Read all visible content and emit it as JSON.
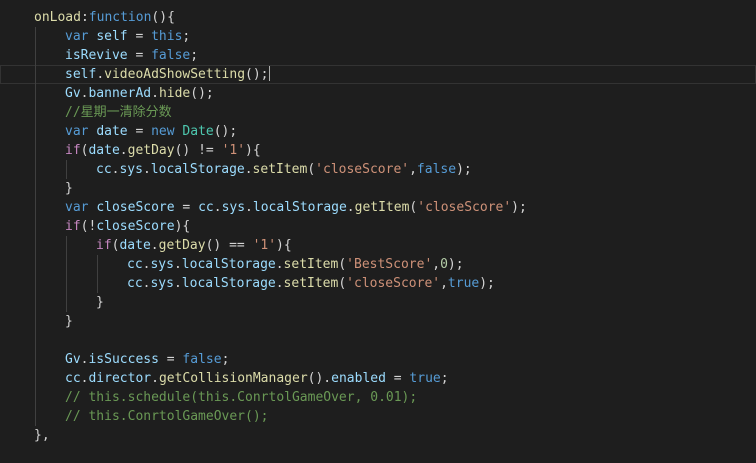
{
  "colors": {
    "background": "#1e1e1e",
    "default": "#d4d4d4",
    "keyword": "#569cd6",
    "identifier": "#9cdcfe",
    "function": "#dcdcaa",
    "string": "#ce9178",
    "comment": "#6a9955",
    "number": "#b5cea8",
    "control": "#c586c0",
    "class": "#4ec9b0",
    "indent_guide": "#404040"
  },
  "editor": {
    "lines": [
      {
        "indent": 0,
        "tokens": [
          {
            "t": "onLoad",
            "k": "function"
          },
          {
            "t": ":",
            "k": "default"
          },
          {
            "t": "function",
            "k": "keyword"
          },
          {
            "t": "(){",
            "k": "default"
          }
        ]
      },
      {
        "indent": 1,
        "tokens": [
          {
            "t": "var ",
            "k": "keyword"
          },
          {
            "t": "self",
            "k": "identifier"
          },
          {
            "t": " = ",
            "k": "default"
          },
          {
            "t": "this",
            "k": "keyword"
          },
          {
            "t": ";",
            "k": "default"
          }
        ]
      },
      {
        "indent": 1,
        "tokens": [
          {
            "t": "isRevive",
            "k": "identifier"
          },
          {
            "t": " = ",
            "k": "default"
          },
          {
            "t": "false",
            "k": "keyword"
          },
          {
            "t": ";",
            "k": "default"
          }
        ]
      },
      {
        "indent": 1,
        "current": true,
        "tokens": [
          {
            "t": "self",
            "k": "identifier"
          },
          {
            "t": ".",
            "k": "default"
          },
          {
            "t": "videoAdShowSetting",
            "k": "function"
          },
          {
            "t": "();",
            "k": "default"
          }
        ]
      },
      {
        "indent": 1,
        "tokens": [
          {
            "t": "Gv",
            "k": "identifier"
          },
          {
            "t": ".",
            "k": "default"
          },
          {
            "t": "bannerAd",
            "k": "identifier"
          },
          {
            "t": ".",
            "k": "default"
          },
          {
            "t": "hide",
            "k": "function"
          },
          {
            "t": "();",
            "k": "default"
          }
        ]
      },
      {
        "indent": 1,
        "tokens": [
          {
            "t": "//星期一清除分数",
            "k": "comment"
          }
        ]
      },
      {
        "indent": 1,
        "tokens": [
          {
            "t": "var ",
            "k": "keyword"
          },
          {
            "t": "date",
            "k": "identifier"
          },
          {
            "t": " = ",
            "k": "default"
          },
          {
            "t": "new ",
            "k": "keyword"
          },
          {
            "t": "Date",
            "k": "class"
          },
          {
            "t": "();",
            "k": "default"
          }
        ]
      },
      {
        "indent": 1,
        "tokens": [
          {
            "t": "if",
            "k": "control"
          },
          {
            "t": "(",
            "k": "default"
          },
          {
            "t": "date",
            "k": "identifier"
          },
          {
            "t": ".",
            "k": "default"
          },
          {
            "t": "getDay",
            "k": "function"
          },
          {
            "t": "() != ",
            "k": "default"
          },
          {
            "t": "'1'",
            "k": "string"
          },
          {
            "t": "){",
            "k": "default"
          }
        ]
      },
      {
        "indent": 2,
        "tokens": [
          {
            "t": "cc",
            "k": "identifier"
          },
          {
            "t": ".",
            "k": "default"
          },
          {
            "t": "sys",
            "k": "identifier"
          },
          {
            "t": ".",
            "k": "default"
          },
          {
            "t": "localStorage",
            "k": "identifier"
          },
          {
            "t": ".",
            "k": "default"
          },
          {
            "t": "setItem",
            "k": "function"
          },
          {
            "t": "(",
            "k": "default"
          },
          {
            "t": "'closeScore'",
            "k": "string"
          },
          {
            "t": ",",
            "k": "default"
          },
          {
            "t": "false",
            "k": "keyword"
          },
          {
            "t": ");",
            "k": "default"
          }
        ]
      },
      {
        "indent": 1,
        "tokens": [
          {
            "t": "}",
            "k": "default"
          }
        ]
      },
      {
        "indent": 1,
        "tokens": [
          {
            "t": "var ",
            "k": "keyword"
          },
          {
            "t": "closeScore",
            "k": "identifier"
          },
          {
            "t": " = ",
            "k": "default"
          },
          {
            "t": "cc",
            "k": "identifier"
          },
          {
            "t": ".",
            "k": "default"
          },
          {
            "t": "sys",
            "k": "identifier"
          },
          {
            "t": ".",
            "k": "default"
          },
          {
            "t": "localStorage",
            "k": "identifier"
          },
          {
            "t": ".",
            "k": "default"
          },
          {
            "t": "getItem",
            "k": "function"
          },
          {
            "t": "(",
            "k": "default"
          },
          {
            "t": "'closeScore'",
            "k": "string"
          },
          {
            "t": ");",
            "k": "default"
          }
        ]
      },
      {
        "indent": 1,
        "tokens": [
          {
            "t": "if",
            "k": "control"
          },
          {
            "t": "(!",
            "k": "default"
          },
          {
            "t": "closeScore",
            "k": "identifier"
          },
          {
            "t": "){",
            "k": "default"
          }
        ]
      },
      {
        "indent": 2,
        "tokens": [
          {
            "t": "if",
            "k": "control"
          },
          {
            "t": "(",
            "k": "default"
          },
          {
            "t": "date",
            "k": "identifier"
          },
          {
            "t": ".",
            "k": "default"
          },
          {
            "t": "getDay",
            "k": "function"
          },
          {
            "t": "() == ",
            "k": "default"
          },
          {
            "t": "'1'",
            "k": "string"
          },
          {
            "t": "){",
            "k": "default"
          }
        ]
      },
      {
        "indent": 3,
        "tokens": [
          {
            "t": "cc",
            "k": "identifier"
          },
          {
            "t": ".",
            "k": "default"
          },
          {
            "t": "sys",
            "k": "identifier"
          },
          {
            "t": ".",
            "k": "default"
          },
          {
            "t": "localStorage",
            "k": "identifier"
          },
          {
            "t": ".",
            "k": "default"
          },
          {
            "t": "setItem",
            "k": "function"
          },
          {
            "t": "(",
            "k": "default"
          },
          {
            "t": "'BestScore'",
            "k": "string"
          },
          {
            "t": ",",
            "k": "default"
          },
          {
            "t": "0",
            "k": "number"
          },
          {
            "t": ");",
            "k": "default"
          }
        ]
      },
      {
        "indent": 3,
        "tokens": [
          {
            "t": "cc",
            "k": "identifier"
          },
          {
            "t": ".",
            "k": "default"
          },
          {
            "t": "sys",
            "k": "identifier"
          },
          {
            "t": ".",
            "k": "default"
          },
          {
            "t": "localStorage",
            "k": "identifier"
          },
          {
            "t": ".",
            "k": "default"
          },
          {
            "t": "setItem",
            "k": "function"
          },
          {
            "t": "(",
            "k": "default"
          },
          {
            "t": "'closeScore'",
            "k": "string"
          },
          {
            "t": ",",
            "k": "default"
          },
          {
            "t": "true",
            "k": "keyword"
          },
          {
            "t": ");",
            "k": "default"
          }
        ]
      },
      {
        "indent": 2,
        "tokens": [
          {
            "t": "}",
            "k": "default"
          }
        ]
      },
      {
        "indent": 1,
        "tokens": [
          {
            "t": "}",
            "k": "default"
          }
        ]
      },
      {
        "indent": 1,
        "tokens": []
      },
      {
        "indent": 1,
        "tokens": [
          {
            "t": "Gv",
            "k": "identifier"
          },
          {
            "t": ".",
            "k": "default"
          },
          {
            "t": "isSuccess",
            "k": "identifier"
          },
          {
            "t": " = ",
            "k": "default"
          },
          {
            "t": "false",
            "k": "keyword"
          },
          {
            "t": ";",
            "k": "default"
          }
        ]
      },
      {
        "indent": 1,
        "tokens": [
          {
            "t": "cc",
            "k": "identifier"
          },
          {
            "t": ".",
            "k": "default"
          },
          {
            "t": "director",
            "k": "identifier"
          },
          {
            "t": ".",
            "k": "default"
          },
          {
            "t": "getCollisionManager",
            "k": "function"
          },
          {
            "t": "().",
            "k": "default"
          },
          {
            "t": "enabled",
            "k": "identifier"
          },
          {
            "t": " = ",
            "k": "default"
          },
          {
            "t": "true",
            "k": "keyword"
          },
          {
            "t": ";",
            "k": "default"
          }
        ]
      },
      {
        "indent": 1,
        "tokens": [
          {
            "t": "// this.schedule(this.ConrtolGameOver, 0.01);",
            "k": "comment"
          }
        ]
      },
      {
        "indent": 1,
        "tokens": [
          {
            "t": "// this.ConrtolGameOver();",
            "k": "comment"
          }
        ]
      },
      {
        "indent": 0,
        "tokens": [
          {
            "t": "},",
            "k": "default"
          }
        ]
      }
    ]
  }
}
